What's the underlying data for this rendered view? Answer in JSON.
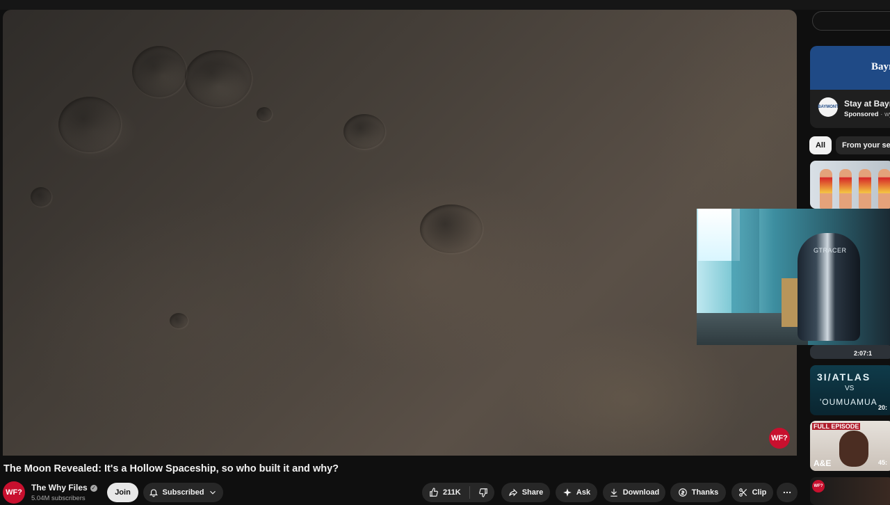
{
  "video": {
    "title": "The Moon Revealed: It's a Hollow Spaceship, so who built it and why?",
    "watermark": "WF?"
  },
  "webcam": {
    "chair_brand": "GTRACER"
  },
  "channel": {
    "avatar_text": "WF?",
    "name": "The Why Files",
    "subscribers": "5.04M subscribers",
    "join_label": "Join",
    "subscribed_label": "Subscribed"
  },
  "actions": {
    "likes": "211K",
    "share": "Share",
    "ask": "Ask",
    "download": "Download",
    "thanks": "Thanks",
    "clip": "Clip"
  },
  "sidebar": {
    "ad": {
      "banner_text": "Bayr",
      "logo_text": "BAYMONT",
      "title": "Stay at Bayr",
      "sponsored": "Sponsored",
      "sponsor_suffix": " · wy"
    },
    "chips": [
      "All",
      "From your sea"
    ],
    "recs": [
      {
        "duration": "2:07:1"
      },
      {
        "line1": "3I/ATLAS",
        "line2": "VS",
        "line3": "'OUMUAMUA",
        "duration": "20:"
      },
      {
        "label": "FULL EPISODE",
        "network": "A&E",
        "duration": "45:"
      },
      {
        "badge": "WF?"
      }
    ]
  },
  "colors": {
    "background": "#0f0f0f",
    "brand_red": "#c8102e",
    "pill": "#272727"
  }
}
